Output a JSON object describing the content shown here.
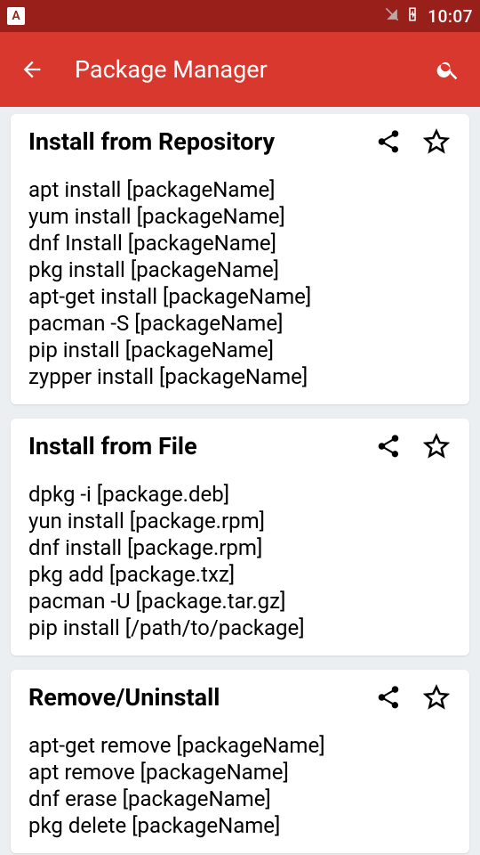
{
  "status": {
    "badge": "A",
    "time": "10:07"
  },
  "appbar": {
    "title": "Package Manager"
  },
  "cards": [
    {
      "title": "Install from Repository",
      "body": "apt install [packageName]\nyum install [packageName]\ndnf Install [packageName]\npkg install [packageName]\napt-get install [packageName]\npacman -S [packageName]\npip install [packageName]\nzypper install [packageName]"
    },
    {
      "title": "Install from File",
      "body": "dpkg -i [package.deb]\nyun install [package.rpm]\ndnf install [package.rpm]\npkg add [package.txz]\npacman -U [package.tar.gz]\npip install [/path/to/package]"
    },
    {
      "title": "Remove/Uninstall",
      "body": "apt-get remove [packageName]\napt remove [packageName]\ndnf erase [packageName]\npkg delete [packageName]"
    }
  ]
}
